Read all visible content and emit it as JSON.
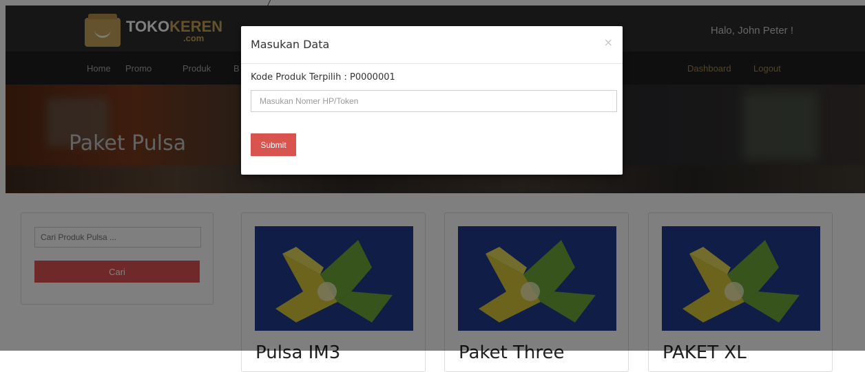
{
  "brand": {
    "name_part1": "TOKO",
    "name_part2": "KEREN",
    "suffix": ".com"
  },
  "header": {
    "greeting": "Halo, John Peter !"
  },
  "nav": {
    "left": [
      "Home",
      "Promo",
      "Produk",
      "B"
    ],
    "right": [
      "Dashboard",
      "Logout"
    ]
  },
  "hero": {
    "title": "Paket Pulsa"
  },
  "search": {
    "placeholder": "Cari Produk Pulsa ...",
    "button": "Cari"
  },
  "cards": [
    {
      "title": "Pulsa IM3"
    },
    {
      "title": "Paket Three"
    },
    {
      "title": "PAKET XL"
    }
  ],
  "modal": {
    "title": "Masukan Data",
    "close": "×",
    "selected_label": "Kode Produk Terpilih : P0000001",
    "input_placeholder": "Masukan Nomer HP/Token",
    "submit": "Submit"
  },
  "colors": {
    "header_bg": "#2d2d2d",
    "nav_bg": "#1f1f1f",
    "brand_gold": "#c9a25a",
    "button_red": "#d9534f",
    "card_image_bg": "#1f3a8f"
  }
}
